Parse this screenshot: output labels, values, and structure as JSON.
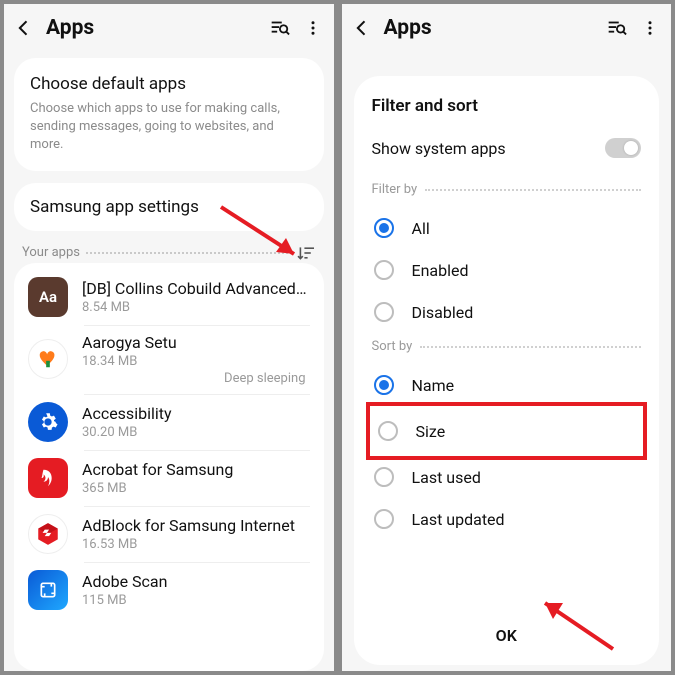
{
  "left": {
    "header": {
      "title": "Apps"
    },
    "default_apps": {
      "title": "Choose default apps",
      "subtitle": "Choose which apps to use for making calls, sending messages, going to websites, and more."
    },
    "samsung": {
      "title": "Samsung app settings"
    },
    "your_apps_label": "Your apps",
    "apps": [
      {
        "name": "[DB] Collins Cobuild Advanced Di..",
        "size": "8.54 MB",
        "icon": "Aa",
        "bg": "#5a3a2e",
        "shape": "rounded",
        "status": ""
      },
      {
        "name": "Aarogya Setu",
        "size": "18.34 MB",
        "icon": "heart",
        "bg": "#fff",
        "status": "Deep sleeping"
      },
      {
        "name": "Accessibility",
        "size": "30.20 MB",
        "icon": "gear",
        "bg": "#0a5ad6",
        "status": ""
      },
      {
        "name": "Acrobat for Samsung",
        "size": "365 MB",
        "icon": "acrobat",
        "bg": "#e51c23",
        "status": ""
      },
      {
        "name": "AdBlock for Samsung Internet",
        "size": "16.53 MB",
        "icon": "adblock",
        "bg": "#fff",
        "status": ""
      },
      {
        "name": "Adobe Scan",
        "size": "115 MB",
        "icon": "scan",
        "bg": "#0a5ad6",
        "shape": "rounded",
        "status": ""
      }
    ]
  },
  "right": {
    "header": {
      "title": "Apps"
    },
    "modal": {
      "title": "Filter and sort",
      "show_system": {
        "label": "Show system apps",
        "on": false
      },
      "filter_label": "Filter by",
      "filter_options": [
        {
          "label": "All",
          "checked": true
        },
        {
          "label": "Enabled",
          "checked": false
        },
        {
          "label": "Disabled",
          "checked": false
        }
      ],
      "sort_label": "Sort by",
      "sort_options": [
        {
          "label": "Name",
          "checked": true
        },
        {
          "label": "Size",
          "checked": false,
          "highlight": true
        },
        {
          "label": "Last used",
          "checked": false
        },
        {
          "label": "Last updated",
          "checked": false
        }
      ],
      "ok_label": "OK"
    }
  }
}
